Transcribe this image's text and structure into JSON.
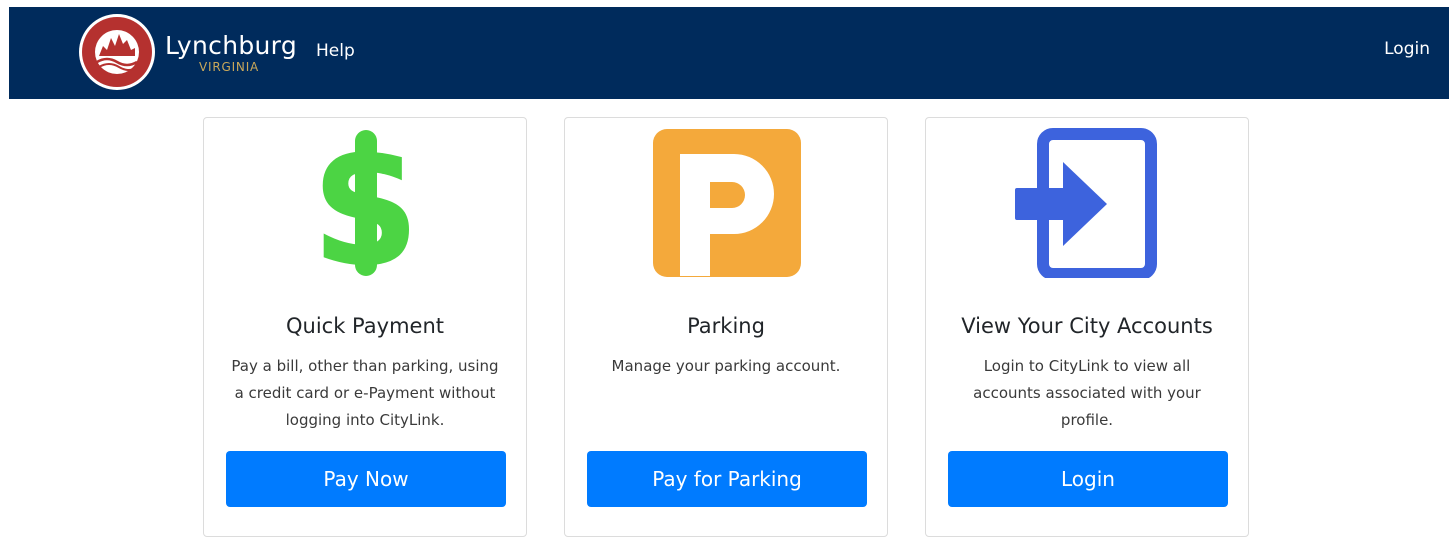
{
  "header": {
    "logo_name": "city-of-lynchburg-seal",
    "brand_name": "Lynchburg",
    "brand_sub": "VIRGINIA",
    "help_label": "Help",
    "login_label": "Login",
    "bg_color": "#002b5c"
  },
  "cards": [
    {
      "icon": "dollar-sign-icon",
      "title": "Quick Payment",
      "description": "Pay a bill, other than parking, using a credit card or e-Payment without logging into CityLink.",
      "button_label": "Pay Now",
      "icon_color": "#4cd444"
    },
    {
      "icon": "parking-icon",
      "title": "Parking",
      "description": "Manage your parking account.",
      "button_label": "Pay for Parking",
      "icon_color": "#f4a93b"
    },
    {
      "icon": "login-arrow-icon",
      "title": "View Your City Accounts",
      "description": "Login to CityLink to view all accounts associated with your profile.",
      "button_label": "Login",
      "icon_color": "#3d63dd"
    }
  ],
  "colors": {
    "button": "#007bff",
    "card_border": "#dcdcdc"
  }
}
